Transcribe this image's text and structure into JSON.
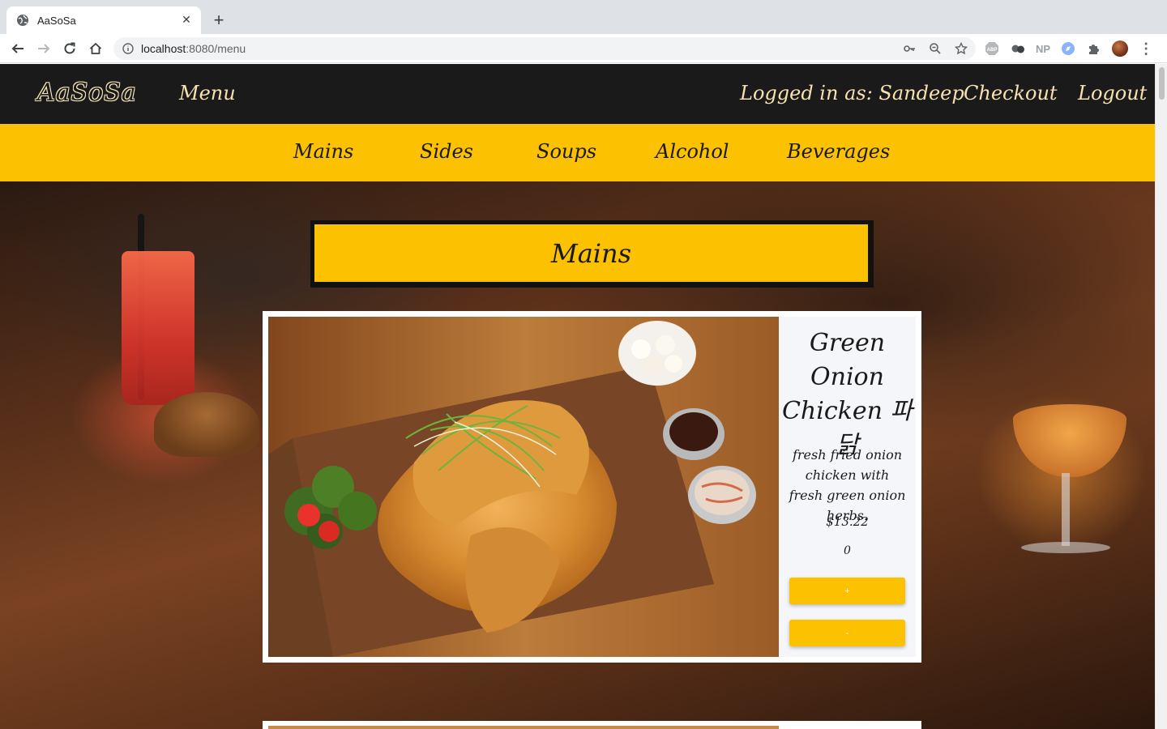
{
  "browser": {
    "tab_title": "AaSoSa",
    "tab_close": "✕",
    "new_tab": "+",
    "url_host": "localhost",
    "url_path": ":8080/menu",
    "extension_np": "NP",
    "menu": "⋮"
  },
  "site": {
    "logo": "AaSoSa",
    "nav_menu": "Menu",
    "logged_in": "Logged in as: Sandeep",
    "checkout": "Checkout",
    "logout": "Logout"
  },
  "categories": [
    "Mains",
    "Sides",
    "Soups",
    "Alcohol",
    "Beverages"
  ],
  "section_title": "Mains",
  "dish": {
    "name": "Green Onion Chicken 파닭",
    "description": "fresh fried onion chicken with fresh green onion herbs.",
    "price": "$13.22",
    "quantity": "0",
    "add_label": "+",
    "remove_label": "-"
  },
  "colors": {
    "accent_yellow": "#fcc101",
    "header_dark": "#1a1a1a",
    "header_text": "#f6e2b0"
  }
}
